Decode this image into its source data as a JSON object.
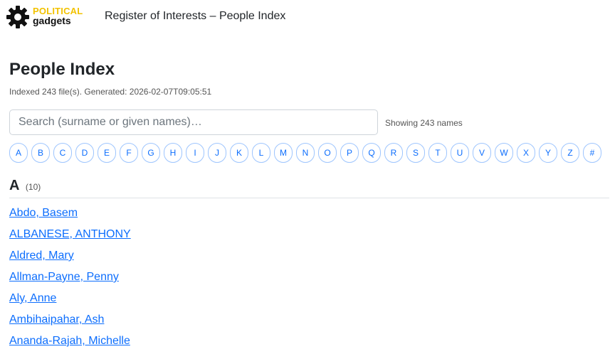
{
  "brand": {
    "line1": "POLITICAL",
    "line2": "gadgets",
    "icon": "gear-icon",
    "accent_color": "#f2c200"
  },
  "header": {
    "title": "Register of Interests – People Index"
  },
  "main": {
    "title": "People Index",
    "meta": "Indexed 243 file(s). Generated: 2026-02-07T09:05:51",
    "search": {
      "placeholder": "Search (surname or given names)…",
      "value": ""
    },
    "showing": "Showing 243 names",
    "alphabet": [
      "A",
      "B",
      "C",
      "D",
      "E",
      "F",
      "G",
      "H",
      "I",
      "J",
      "K",
      "L",
      "M",
      "N",
      "O",
      "P",
      "Q",
      "R",
      "S",
      "T",
      "U",
      "V",
      "W",
      "X",
      "Y",
      "Z",
      "#"
    ],
    "sections": [
      {
        "letter": "A",
        "count": "(10)",
        "people": [
          "Abdo, Basem",
          "ALBANESE, ANTHONY",
          "Aldred, Mary",
          "Allman-Payne, Penny",
          "Aly, Anne",
          "Ambihaipahar, Ash",
          "Ananda-Rajah, Michelle"
        ]
      }
    ]
  },
  "colors": {
    "link": "#0d6efd",
    "pill_border": "#9ec5fe",
    "text": "#212529",
    "muted": "#555555"
  }
}
